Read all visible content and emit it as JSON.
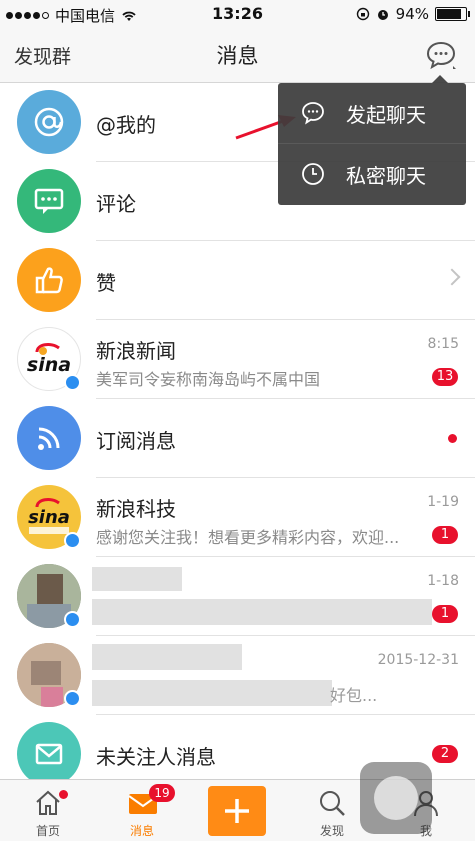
{
  "status_bar": {
    "carrier": "中国电信",
    "time": "13:26",
    "battery": "94%",
    "battery_level": 0.94
  },
  "nav": {
    "left": "发现群",
    "title": "消息",
    "chat_icon": "chat-bubble-icon"
  },
  "dropdown": {
    "items": [
      {
        "label": "发起聊天",
        "icon": "chat-bubble-icon"
      },
      {
        "label": "私密聊天",
        "icon": "clock-icon"
      }
    ]
  },
  "rows": [
    {
      "name": "@我的",
      "icon": "at-icon",
      "color": "#5aabdb"
    },
    {
      "name": "评论",
      "icon": "comment-icon",
      "color": "#34b87a"
    },
    {
      "name": "赞",
      "icon": "thumbs-up-icon",
      "color": "#fca11c"
    },
    {
      "name": "新浪新闻",
      "sub": "美军司令妄称南海岛屿不属中国",
      "time": "8:15",
      "badge": "13"
    },
    {
      "name": "订阅消息",
      "icon": "rss-icon",
      "color": "#4f8ee8"
    },
    {
      "name": "新浪科技",
      "sub": "感谢您关注我！想看更多精彩内容，欢迎...",
      "time": "1-19",
      "badge": "1"
    },
    {
      "name": "",
      "sub": "",
      "time": "1-18",
      "badge": "1"
    },
    {
      "name": "",
      "sub": "好包...",
      "time": "2015-12-31"
    },
    {
      "name": "未关注人消息",
      "icon": "mail-icon",
      "color": "#4cc7b7",
      "badge": "2"
    }
  ],
  "tabs": [
    {
      "label": "首页",
      "icon": "home-icon"
    },
    {
      "label": "消息",
      "icon": "message-icon",
      "badge": "19"
    },
    {
      "label": "",
      "icon": "plus-icon"
    },
    {
      "label": "发现",
      "icon": "search-icon"
    },
    {
      "label": "我",
      "icon": "person-icon"
    }
  ],
  "colors": {
    "accent": "#fa7d00",
    "badge": "#e8112d",
    "dropdown_bg": "#3c3c3c"
  }
}
